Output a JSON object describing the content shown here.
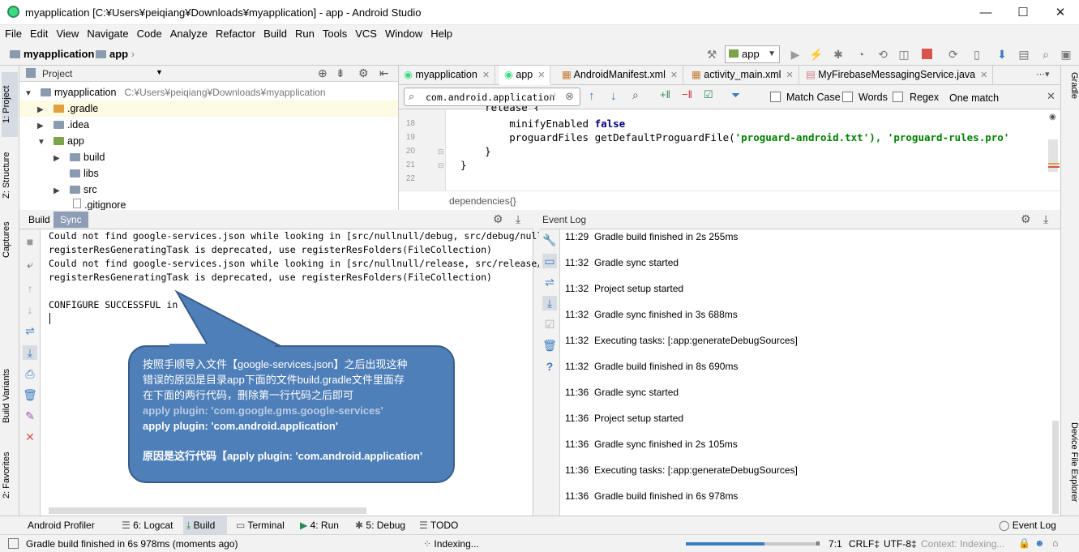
{
  "window": {
    "title": "myapplication [C:¥Users¥peiqiang¥Downloads¥myapplication] - app - Android Studio",
    "min": "—",
    "max": "☐",
    "close": "✕"
  },
  "menu": [
    "File",
    "Edit",
    "View",
    "Navigate",
    "Code",
    "Analyze",
    "Refactor",
    "Build",
    "Run",
    "Tools",
    "VCS",
    "Window",
    "Help"
  ],
  "nav": {
    "crumb1": "myapplication",
    "crumb2": "app",
    "run_config": "app"
  },
  "left_tabs": {
    "project": "1: Project",
    "structure": "Z: Structure",
    "captures": "Captures",
    "build_variants": "Build Variants",
    "favorites": "2: Favorites"
  },
  "right_tabs": {
    "gradle": "Gradle",
    "device_explorer": "Device File Explorer"
  },
  "project": {
    "header": "Project",
    "tree": [
      {
        "label": "myapplication",
        "path": "C:¥Users¥peiqiang¥Downloads¥myapplication",
        "arrow": "▼"
      },
      {
        "label": ".gradle",
        "arrow": "▶"
      },
      {
        "label": ".idea",
        "arrow": "▶"
      },
      {
        "label": "app",
        "arrow": "▼"
      },
      {
        "label": "build",
        "arrow": "▶"
      },
      {
        "label": "libs",
        "arrow": ""
      },
      {
        "label": "src",
        "arrow": "▶"
      },
      {
        "label": ".gitignore",
        "arrow": ""
      }
    ]
  },
  "editor": {
    "tabs": [
      "myapplication",
      "app",
      "AndroidManifest.xml",
      "activity_main.xml",
      "MyFirebaseMessagingService.java"
    ],
    "find": {
      "query": "com.android.application",
      "match_case": "Match Case",
      "words": "Words",
      "regex": "Regex",
      "result": "One match"
    },
    "lines": [
      {
        "n": "18",
        "pre": "        minifyEnabled ",
        "kw": "false",
        "post": "",
        "str": ""
      },
      {
        "n": "19",
        "pre": "        proguardFiles getDefaultProguardFile(",
        "kw": "",
        "str": "'proguard-android.txt'",
        "post": "), 'proguard-rules.pro'"
      },
      {
        "n": "20",
        "pre": "    }",
        "kw": "",
        "str": "",
        "post": ""
      },
      {
        "n": "21",
        "pre": "}",
        "kw": "",
        "str": "",
        "post": ""
      },
      {
        "n": "22",
        "pre": "",
        "kw": "",
        "str": "",
        "post": ""
      }
    ],
    "partial_line": "    release {",
    "breadcrumb": "dependencies{}"
  },
  "build": {
    "tab_build": "Build",
    "tab_sync": "Sync",
    "console": [
      "Could not find google-services.json while looking in [src/nullnull/debug, src/debug/nullnull, src/nu",
      "registerResGeneratingTask is deprecated, use registerResFolders(FileCollection)",
      "Could not find google-services.json while looking in [src/nullnull/release, src/release/nullnull, s",
      "registerResGeneratingTask is deprecated, use registerResFolders(FileCollection)",
      "",
      "CONFIGURE SUCCESSFUL in 0s"
    ]
  },
  "event_log": {
    "title": "Event Log",
    "entries": [
      {
        "time": "11:29",
        "msg": "Gradle build finished in 2s 255ms"
      },
      {
        "time": "11:32",
        "msg": "Gradle sync started"
      },
      {
        "time": "11:32",
        "msg": "Project setup started"
      },
      {
        "time": "11:32",
        "msg": "Gradle sync finished in 3s 688ms"
      },
      {
        "time": "11:32",
        "msg": "Executing tasks: [:app:generateDebugSources]"
      },
      {
        "time": "11:32",
        "msg": "Gradle build finished in 8s 690ms"
      },
      {
        "time": "11:36",
        "msg": "Gradle sync started"
      },
      {
        "time": "11:36",
        "msg": "Project setup started"
      },
      {
        "time": "11:36",
        "msg": "Gradle sync finished in 2s 105ms"
      },
      {
        "time": "11:36",
        "msg": "Executing tasks: [:app:generateDebugSources]"
      },
      {
        "time": "11:36",
        "msg": "Gradle build finished in 6s 978ms"
      }
    ]
  },
  "callout": {
    "line1": "按照手顺导入文件【google-services.json】之后出现这种",
    "line2": "错误的原因是目录app下面的文件build.gradle文件里面存",
    "line3": "在下面的两行代码，删除第一行代码之后即可",
    "code1": "apply plugin: 'com.google.gms.google-services'",
    "code2": "apply plugin: 'com.android.application'",
    "reason": "原因是这行代码【apply plugin: 'com.android.application'"
  },
  "bottom_tools": [
    "Android Profiler",
    "6: Logcat",
    "Build",
    "Terminal",
    "4: Run",
    "5: Debug",
    "TODO"
  ],
  "event_log_button": "Event Log",
  "status": {
    "message": "Gradle build finished in 6s 978ms (moments ago)",
    "indexing": "Indexing...",
    "progress": 0.6,
    "pos": "7:1",
    "crlf": "CRLF‡",
    "enc": "UTF-8‡",
    "context": "Context: Indexing..."
  },
  "colors": {
    "accent": "#4f7fb8",
    "keyword": "#000080",
    "string": "#008000",
    "callout_code": "#b7cbe6"
  }
}
